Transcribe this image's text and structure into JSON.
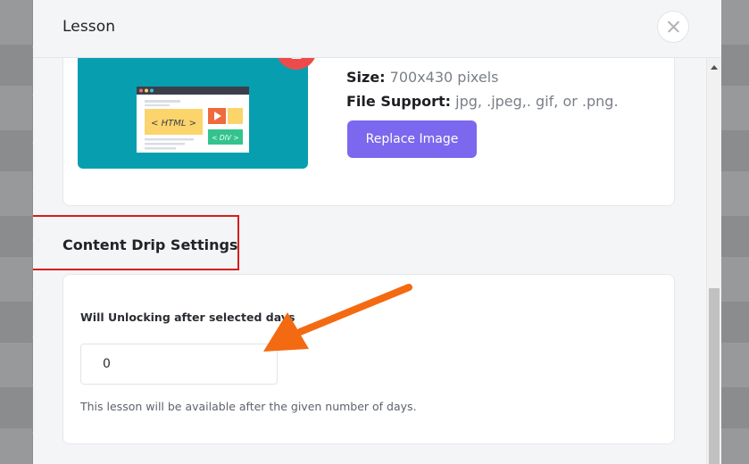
{
  "modal": {
    "title": "Lesson",
    "close_icon": "close-icon"
  },
  "image_section": {
    "size_label": "Size:",
    "size_value": "700x430 pixels",
    "file_support_label": "File Support:",
    "file_support_value": "jpg, .jpeg,. gif, or .png.",
    "replace_button": "Replace Image",
    "delete_icon": "trash-icon",
    "thumbnail_html_label": "< HTML >",
    "thumbnail_div_label": "< DIV >"
  },
  "drip_section": {
    "title": "Content Drip Settings",
    "field_label": "Will Unlocking after selected days",
    "field_value": "0",
    "help_text": "This lesson will be available after the given number of days."
  },
  "colors": {
    "accent": "#7b68ee",
    "delete": "#ed4b4b",
    "thumbnail_bg": "#079faf",
    "highlight": "#d71d1d",
    "arrow": "#f36a12"
  }
}
